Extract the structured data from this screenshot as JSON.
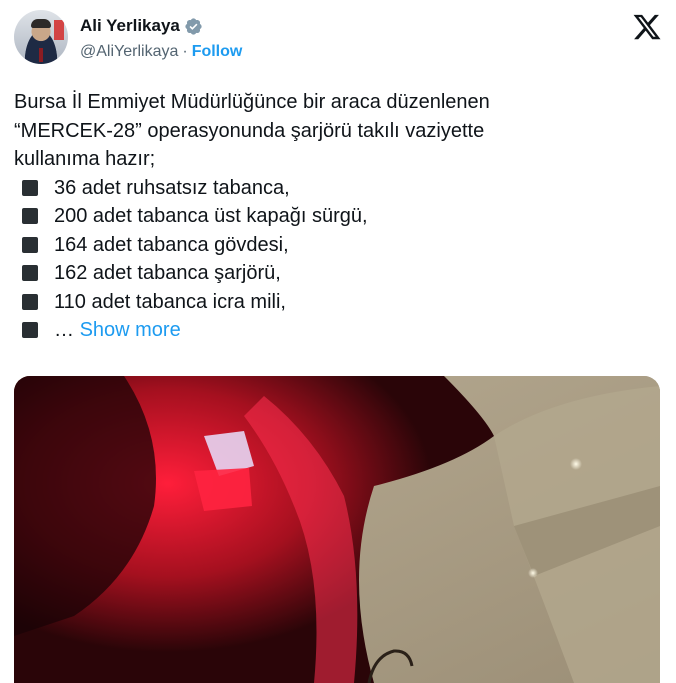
{
  "author": {
    "display_name": "Ali Yerlikaya",
    "handle": "@AliYerlikaya",
    "separator": "·",
    "follow_label": "Follow",
    "verified": true
  },
  "tweet": {
    "lines": [
      "Bursa İl Emmiyet Müdürlüğünce bir araca düzenlenen",
      "“MERCEK-28” operasyonunda şarjörü takılı vaziyette",
      "kullanıma hazır;"
    ],
    "bullets": [
      "36 adet ruhsatsız tabanca,",
      "200 adet tabanca üst kapağı sürgü,",
      "164 adet tabanca gövdesi,",
      "162 adet tabanca şarjörü,",
      "110 adet tabanca icra mili,"
    ],
    "ellipsis": "…",
    "show_more_label": "Show more"
  },
  "colors": {
    "link": "#1d9bf0",
    "text": "#0f1419",
    "secondary": "#536471",
    "bullet": "#292f33"
  },
  "icons": {
    "platform": "x-logo-icon",
    "verified": "verified-badge-icon",
    "bullet": "black-square-icon"
  }
}
